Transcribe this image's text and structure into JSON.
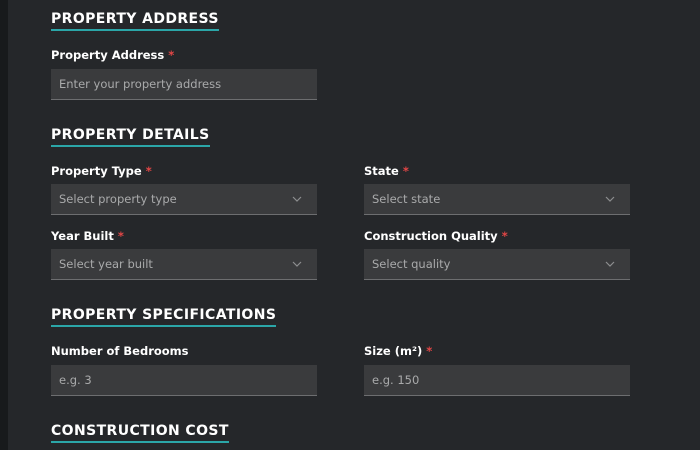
{
  "sections": {
    "address": {
      "title": "PROPERTY ADDRESS",
      "field_label": "Property Address",
      "required_mark": "*",
      "placeholder": "Enter your property address"
    },
    "details": {
      "title": "PROPERTY DETAILS",
      "property_type": {
        "label": "Property Type",
        "required_mark": "*",
        "value": "Select property type"
      },
      "state": {
        "label": "State",
        "required_mark": "*",
        "value": "Select state"
      },
      "year_built": {
        "label": "Year Built",
        "required_mark": "*",
        "value": "Select year built"
      },
      "construction_quality": {
        "label": "Construction Quality",
        "required_mark": "*",
        "value": "Select quality"
      }
    },
    "specifications": {
      "title": "PROPERTY SPECIFICATIONS",
      "bedrooms": {
        "label": "Number of Bedrooms",
        "placeholder": "e.g. 3"
      },
      "size": {
        "label": "Size (m²)",
        "required_mark": "*",
        "placeholder": "e.g. 150"
      }
    },
    "cost": {
      "title": "CONSTRUCTION COST"
    }
  },
  "colors": {
    "background": "#25272a",
    "accent_underline": "#2ba6a8",
    "required": "#e34646",
    "field_bg": "#3a3b3d"
  },
  "icons": {
    "select_arrow": "chevron-down-icon"
  }
}
